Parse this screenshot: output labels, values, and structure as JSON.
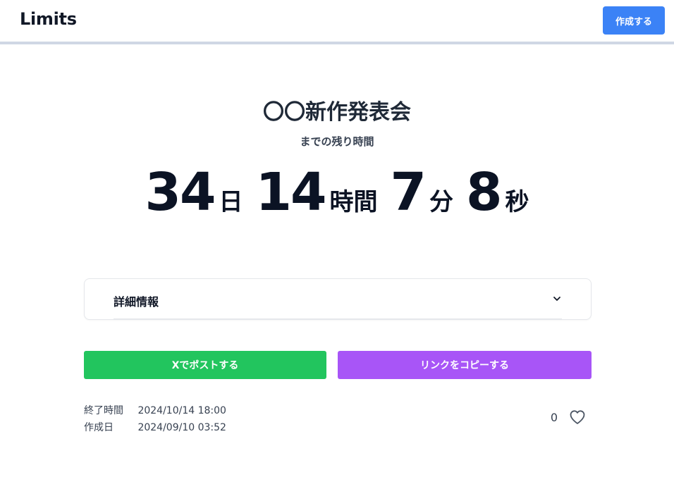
{
  "header": {
    "brand": "Limits",
    "create_label": "作成する"
  },
  "event": {
    "title": "〇〇新作発表会",
    "subtitle": "までの残り時間"
  },
  "countdown": {
    "days": "34",
    "days_unit": "日",
    "hours": "14",
    "hours_unit": "時間",
    "minutes": "7",
    "minutes_unit": "分",
    "seconds": "8",
    "seconds_unit": "秒"
  },
  "details": {
    "label": "詳細情報"
  },
  "actions": {
    "post_x_label": "Xでポストする",
    "copy_link_label": "リンクをコピーする"
  },
  "meta": {
    "end_label": "終了時間",
    "end_value": "2024/10/14 18:00",
    "created_label": "作成日",
    "created_value": "2024/09/10 03:52"
  },
  "likes": {
    "count": "0"
  },
  "colors": {
    "primary": "#3b82f6",
    "x_button": "#22c55e",
    "copy_button": "#a855f7"
  },
  "icons": {
    "details_toggle": "chevron-down-icon",
    "like": "heart-icon"
  }
}
